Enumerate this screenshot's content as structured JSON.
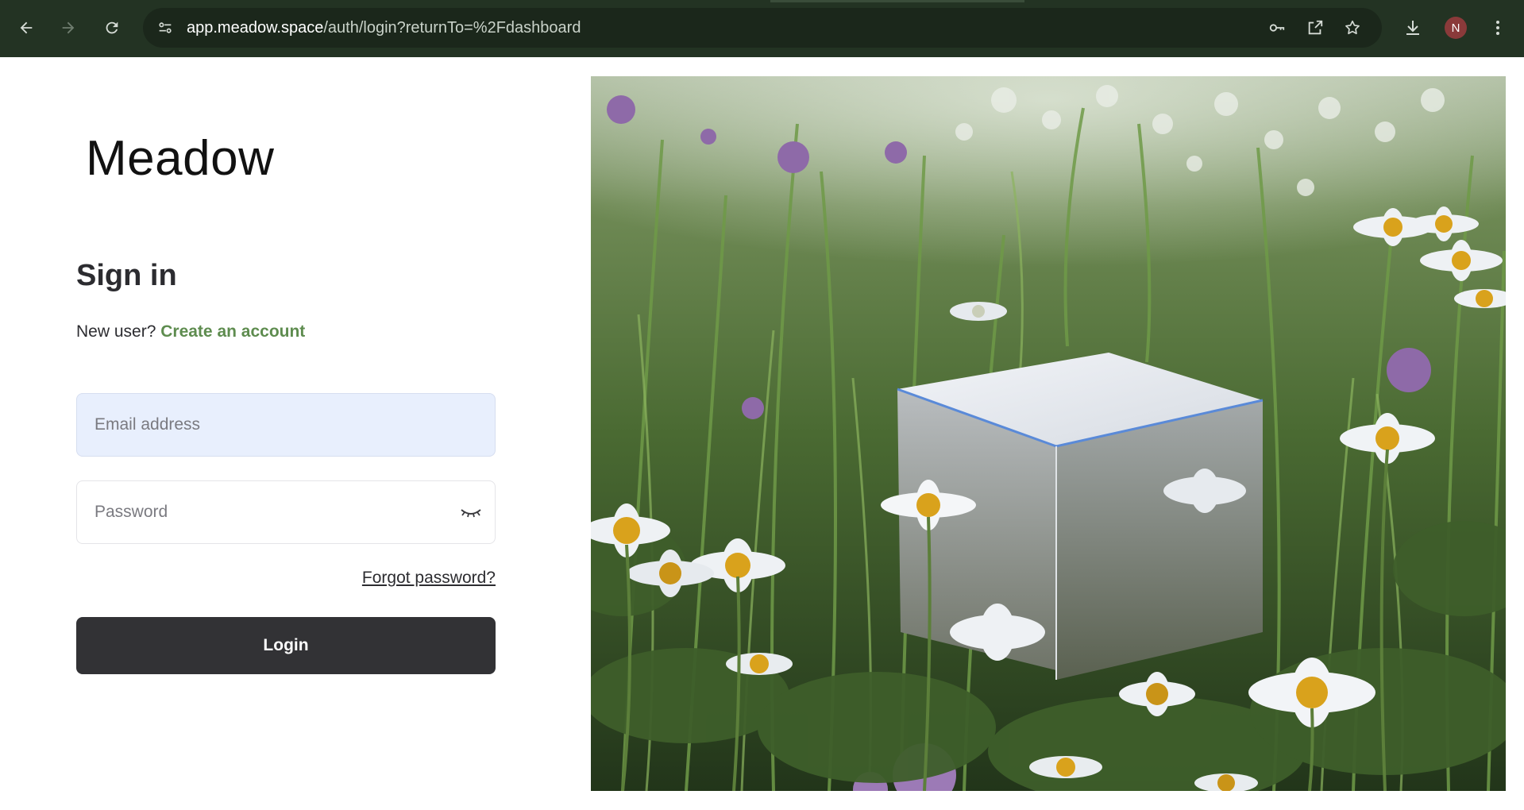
{
  "browser": {
    "url_host": "app.meadow.space",
    "url_path": "/auth/login?returnTo=%2Fdashboard",
    "profile_initial": "N",
    "icons": {
      "back": "back-arrow-icon",
      "forward": "forward-arrow-icon",
      "reload": "reload-icon",
      "site_info": "site-settings-icon",
      "password_manager": "key-icon",
      "open_in_app": "open-external-icon",
      "bookmark": "star-icon",
      "downloads": "download-icon",
      "menu": "more-vertical-icon"
    }
  },
  "brand": {
    "logo_text": "Meadow"
  },
  "form": {
    "heading": "Sign in",
    "new_user_text": "New user?",
    "create_account_link": "Create an account",
    "email_placeholder": "Email address",
    "email_value": "",
    "password_placeholder": "Password",
    "password_value": "",
    "password_toggle_icon": "eye-closed-icon",
    "forgot_password_link": "Forgot password?",
    "login_button": "Login"
  },
  "colors": {
    "chrome_bg": "#233323",
    "accent_link": "#5e8c4f",
    "button_bg": "#323235",
    "email_field_bg": "#e8effd"
  },
  "hero": {
    "subject": "meadow-cube-image"
  }
}
